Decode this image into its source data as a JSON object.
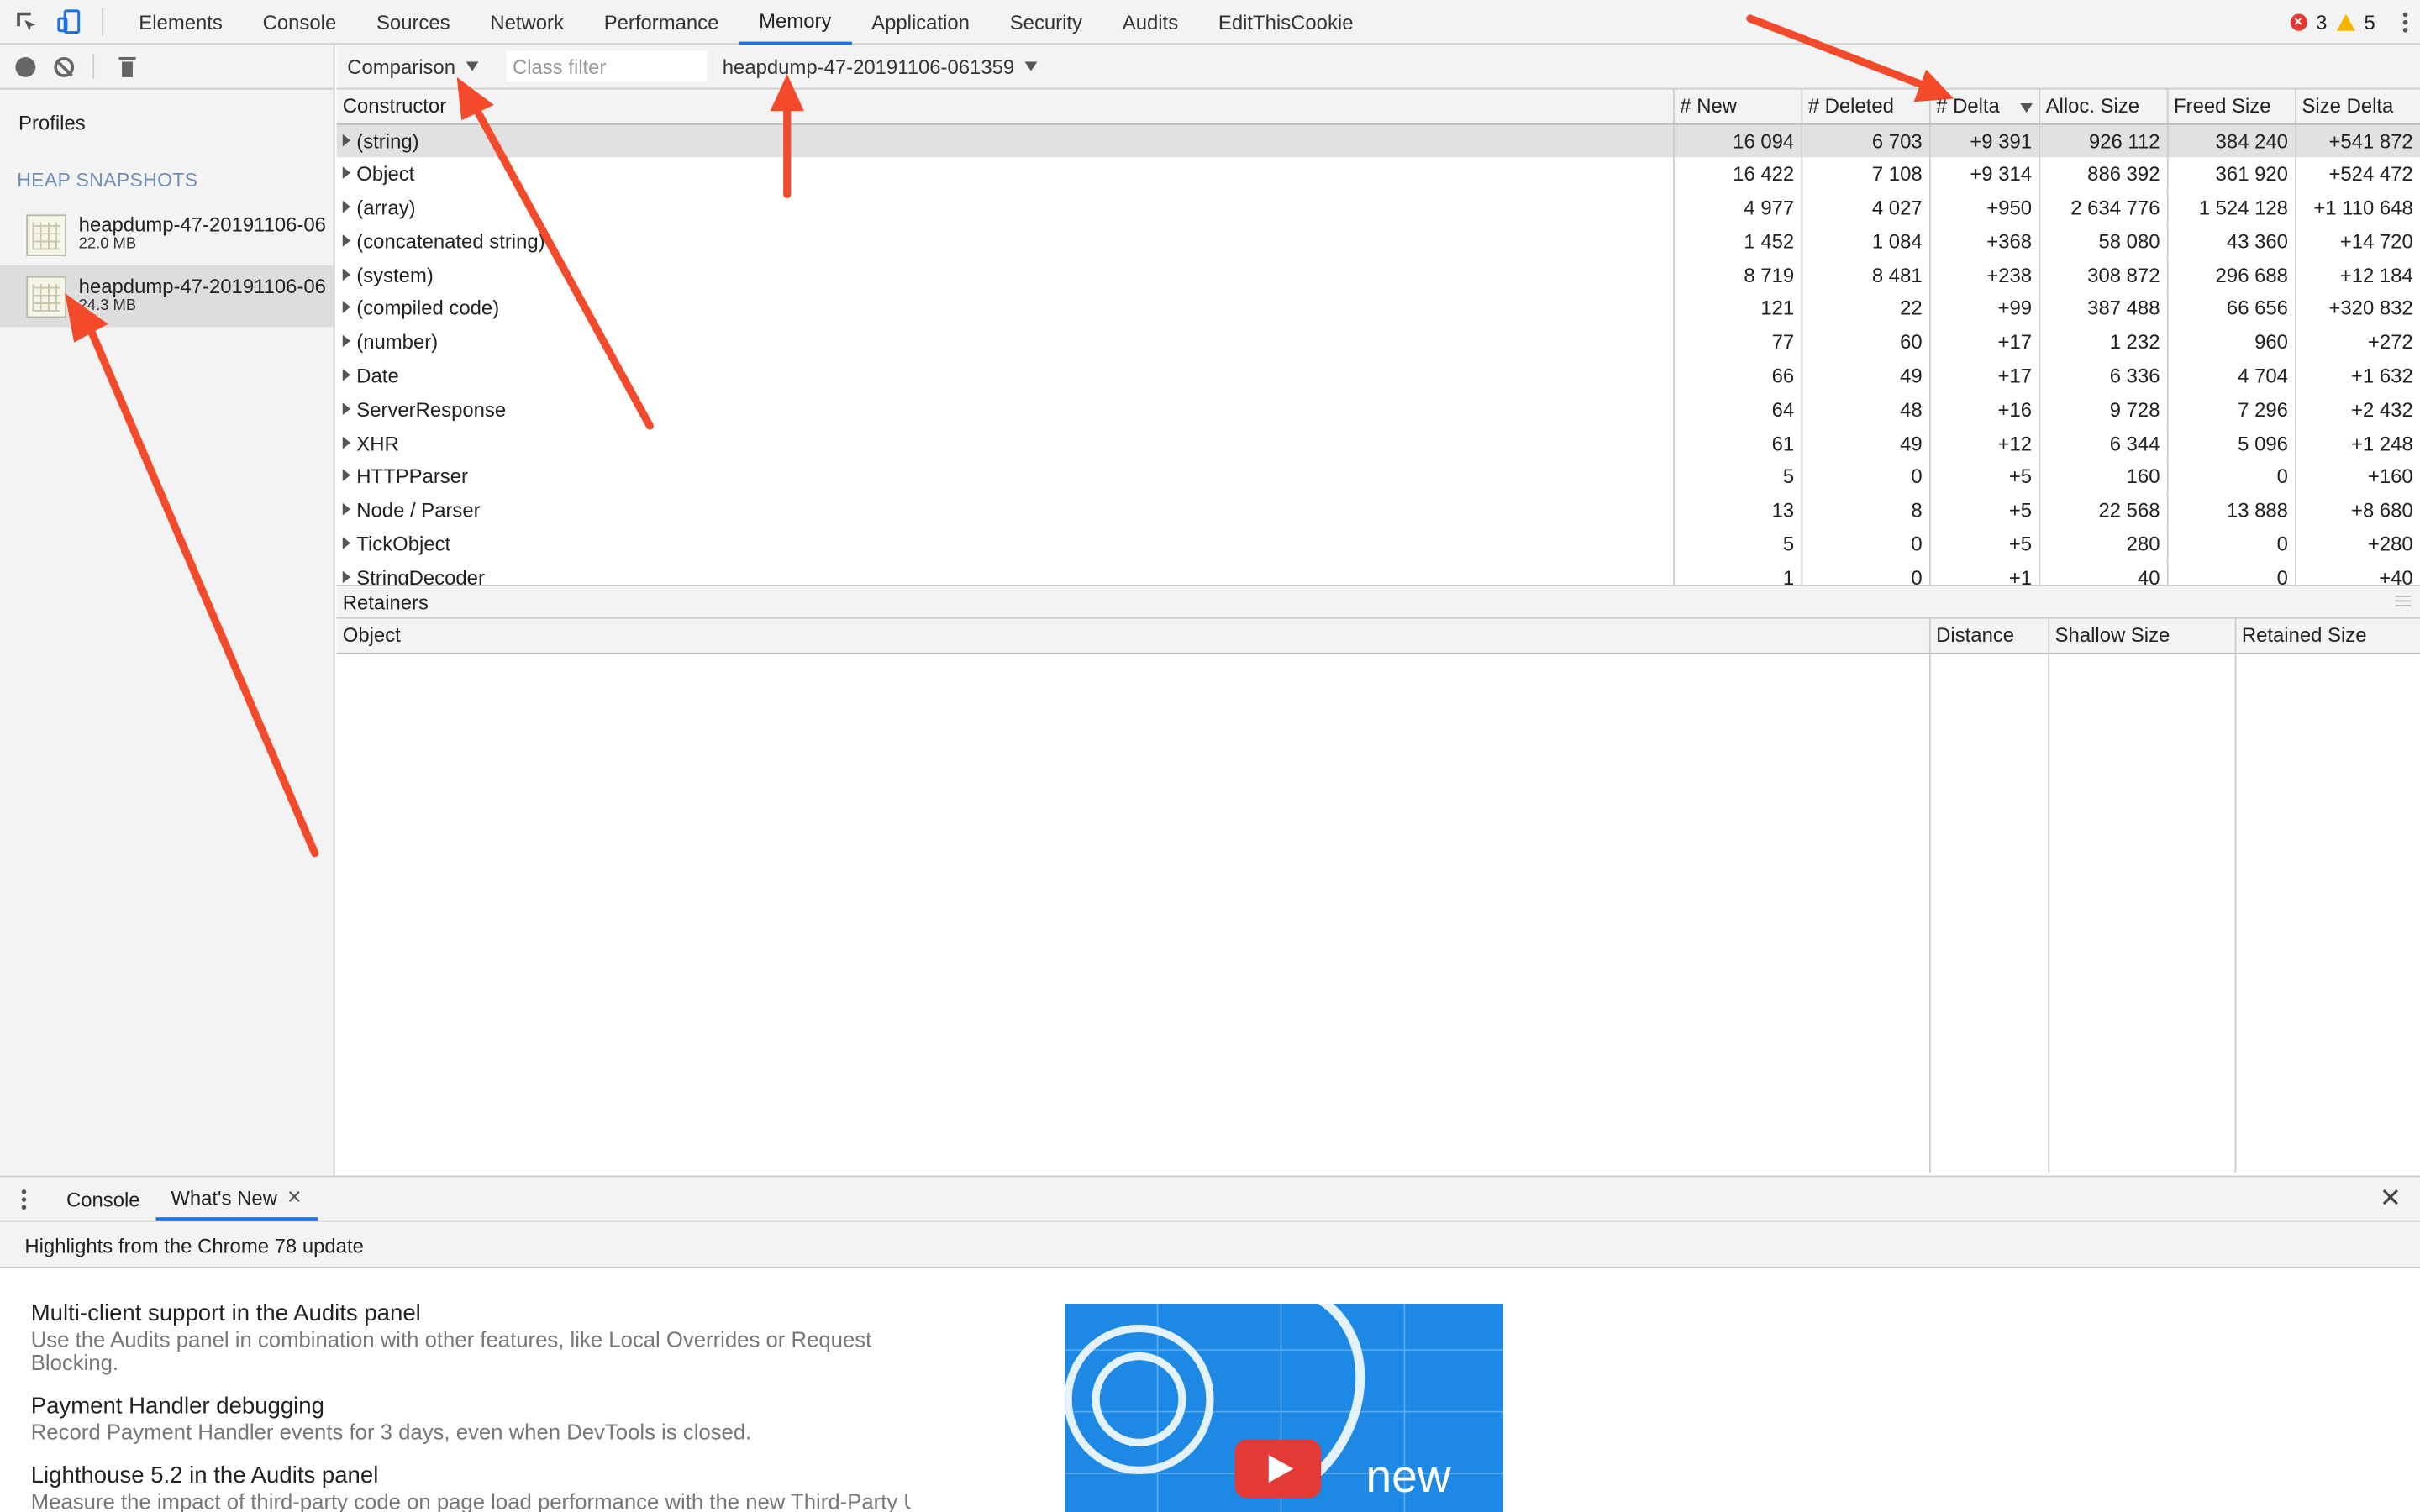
{
  "devtools": {
    "tabs": [
      "Elements",
      "Console",
      "Sources",
      "Network",
      "Performance",
      "Memory",
      "Application",
      "Security",
      "Audits",
      "EditThisCookie"
    ],
    "active_tab": "Memory",
    "error_count": "3",
    "warning_count": "5"
  },
  "sidebar": {
    "profiles_label": "Profiles",
    "section_label": "HEAP SNAPSHOTS",
    "snapshots": [
      {
        "name": "heapdump-47-20191106-06",
        "size": "22.0 MB"
      },
      {
        "name": "heapdump-47-20191106-06",
        "size": "24.3 MB"
      }
    ]
  },
  "toolbar": {
    "view_mode": "Comparison",
    "class_filter_placeholder": "Class filter",
    "compare_snapshot": "heapdump-47-20191106-061359"
  },
  "table": {
    "columns": [
      "Constructor",
      "# New",
      "# Deleted",
      "# Delta",
      "Alloc. Size",
      "Freed Size",
      "Size Delta"
    ],
    "rows": [
      [
        "(string)",
        "16 094",
        "6 703",
        "+9 391",
        "926 112",
        "384 240",
        "+541 872"
      ],
      [
        "Object",
        "16 422",
        "7 108",
        "+9 314",
        "886 392",
        "361 920",
        "+524 472"
      ],
      [
        "(array)",
        "4 977",
        "4 027",
        "+950",
        "2 634 776",
        "1 524 128",
        "+1 110 648"
      ],
      [
        "(concatenated string)",
        "1 452",
        "1 084",
        "+368",
        "58 080",
        "43 360",
        "+14 720"
      ],
      [
        "(system)",
        "8 719",
        "8 481",
        "+238",
        "308 872",
        "296 688",
        "+12 184"
      ],
      [
        "(compiled code)",
        "121",
        "22",
        "+99",
        "387 488",
        "66 656",
        "+320 832"
      ],
      [
        "(number)",
        "77",
        "60",
        "+17",
        "1 232",
        "960",
        "+272"
      ],
      [
        "Date",
        "66",
        "49",
        "+17",
        "6 336",
        "4 704",
        "+1 632"
      ],
      [
        "ServerResponse",
        "64",
        "48",
        "+16",
        "9 728",
        "7 296",
        "+2 432"
      ],
      [
        "XHR",
        "61",
        "49",
        "+12",
        "6 344",
        "5 096",
        "+1 248"
      ],
      [
        "HTTPParser",
        "5",
        "0",
        "+5",
        "160",
        "0",
        "+160"
      ],
      [
        "Node / Parser",
        "13",
        "8",
        "+5",
        "22 568",
        "13 888",
        "+8 680"
      ],
      [
        "TickObject",
        "5",
        "0",
        "+5",
        "280",
        "0",
        "+280"
      ],
      [
        "StringDecoder",
        "1",
        "0",
        "+1",
        "40",
        "0",
        "+40"
      ]
    ]
  },
  "retainers": {
    "title": "Retainers",
    "columns": [
      "Object",
      "Distance",
      "Shallow Size",
      "Retained Size"
    ]
  },
  "drawer": {
    "tabs": [
      "Console",
      "What's New"
    ],
    "active_tab": "What's New",
    "highlights": "Highlights from the Chrome 78 update",
    "items": [
      {
        "title": "Multi-client support in the Audits panel",
        "desc": "Use the Audits panel in combination with other features, like Local Overrides or Request Blocking."
      },
      {
        "title": "Payment Handler debugging",
        "desc": "Record Payment Handler events for 3 days, even when DevTools is closed."
      },
      {
        "title": "Lighthouse 5.2 in the Audits panel",
        "desc": "Measure the impact of third-party code on page load performance with the new Third-Party U"
      }
    ],
    "video_caption": "new"
  },
  "colors": {
    "accent": "#1a73e8",
    "arrow": "#f24a2a",
    "video_bg": "#1e88e5"
  }
}
